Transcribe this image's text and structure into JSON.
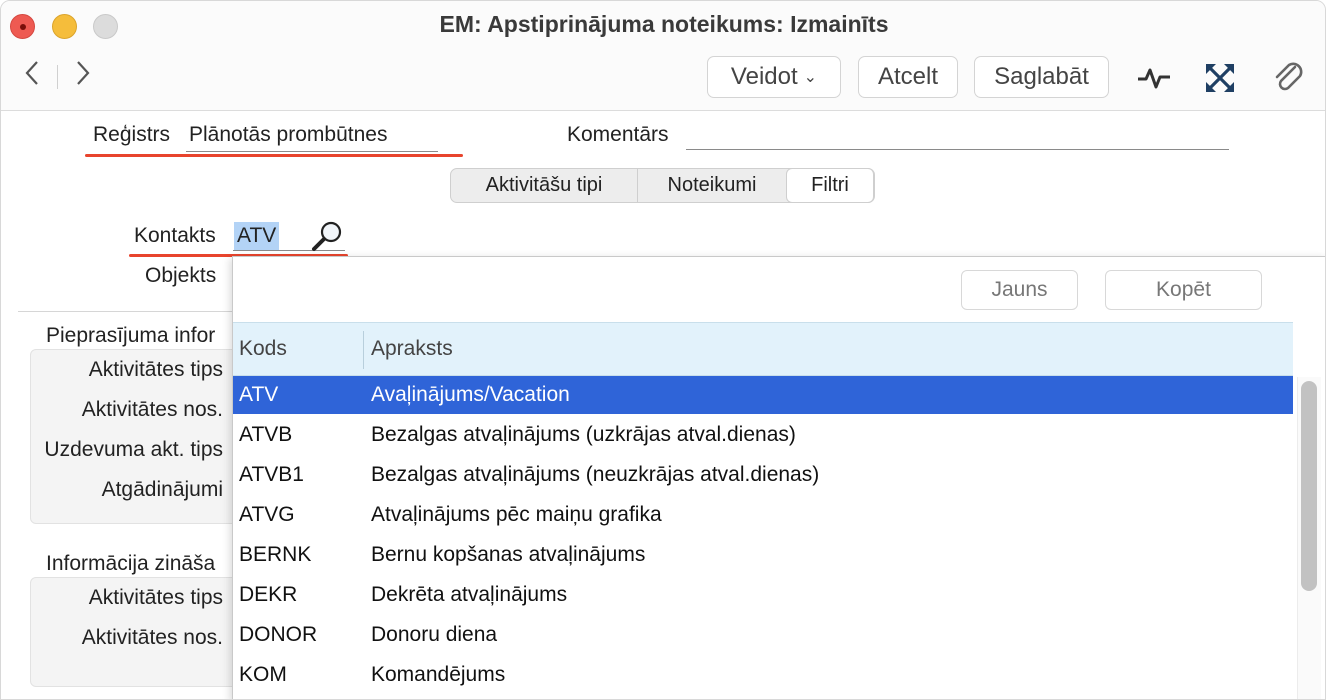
{
  "window": {
    "title": "EM: Apstiprinājuma noteikums: Izmainīts"
  },
  "toolbar": {
    "create_label": "Veidot",
    "cancel_label": "Atcelt",
    "save_label": "Saglabāt"
  },
  "form": {
    "register_label": "Reģistrs",
    "register_value": "Plānotās prombūtnes",
    "comment_label": "Komentārs",
    "comment_value": "",
    "contact_label": "Kontakts",
    "contact_value": "ATV",
    "object_label": "Objekts"
  },
  "tabs": [
    {
      "label": "Aktivitāšu tipi"
    },
    {
      "label": "Noteikumi"
    },
    {
      "label": "Filtri"
    }
  ],
  "sections": {
    "request_title": "Pieprasījuma infor",
    "request_fields": [
      "Aktivitātes tips",
      "Aktivitātes nos.",
      "Uzdevuma akt. tips",
      "Atgādinājumi"
    ],
    "info_title": "Informācija zināša",
    "info_fields": [
      "Aktivitātes tips",
      "Aktivitātes nos."
    ]
  },
  "popup": {
    "new_label": "Jauns",
    "copy_label": "Kopēt",
    "columns": [
      "Kods",
      "Apraksts"
    ],
    "rows": [
      {
        "code": "ATV",
        "description": "Avaļinājums/Vacation",
        "selected": true
      },
      {
        "code": "ATVB",
        "description": "Bezalgas atvaļinājums (uzkrājas atval.dienas)"
      },
      {
        "code": "ATVB1",
        "description": "Bezalgas atvaļinājums (neuzkrājas atval.dienas)"
      },
      {
        "code": "ATVG",
        "description": "Atvaļinājums pēc maiņu grafika"
      },
      {
        "code": "BERNK",
        "description": "Bernu kopšanas atvaļinājums"
      },
      {
        "code": "DEKR",
        "description": "Dekrēta atvaļinājums"
      },
      {
        "code": "DONOR",
        "description": "Donoru diena"
      },
      {
        "code": "KOM",
        "description": "Komandējums"
      }
    ]
  },
  "colors": {
    "accent_red": "#e8442d",
    "selection": "#2f64d8",
    "header_bg": "#e2f2fb"
  }
}
